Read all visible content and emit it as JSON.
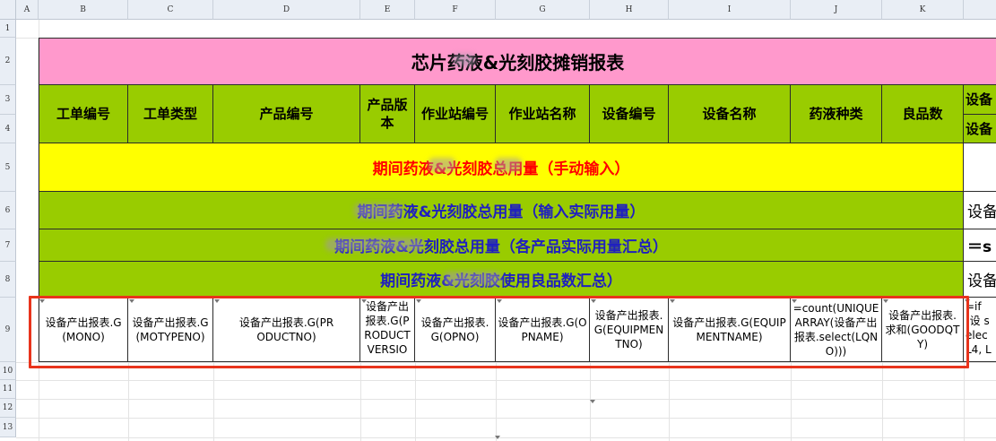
{
  "columns": [
    "A",
    "B",
    "C",
    "D",
    "E",
    "F",
    "G",
    "H",
    "I",
    "J",
    "K"
  ],
  "rows": [
    "1",
    "2",
    "3",
    "4",
    "5",
    "6",
    "7",
    "8",
    "9",
    "10",
    "11",
    "12",
    "13"
  ],
  "title": "芯片药液&光刻胶摊销报表",
  "headers": {
    "mono": "工单编号",
    "motype": "工单类型",
    "productno": "产品编号",
    "productversion": "产品版本",
    "opno": "作业站编号",
    "opname": "作业站名称",
    "equipmentno": "设备编号",
    "equipmentname": "设备名称",
    "liquid_type": "药液种类",
    "good_qty": "良品数",
    "k3_partial": "设备",
    "k4_partial": "设备"
  },
  "bands": {
    "row5": "期间药液&光刻胶总用量（手动输入）",
    "row6": "期间药液&光刻胶总用量（输入实际用量）",
    "row7": "期间药液&光刻胶总用量（各产品实际用量汇总）",
    "row8": "期间药液&光刻胶使用良品数汇总）"
  },
  "side": {
    "row6": "设备",
    "row7": "＝s",
    "row8": "设备"
  },
  "formulas": {
    "b": "设备产出报表.G(MONO)",
    "c": "设备产出报表.G(MOTYPENO)",
    "d": "设备产出报表.G(PRODUCTNO)",
    "e": "设备产出报表.G(PRODUCTVERSIO",
    "f": "设备产出报表.G(OPNO)",
    "g": "设备产出报表.G(OPNAME)",
    "h": "设备产出报表.G(EQUIPMENTNO)",
    "i": "设备产出报表.G(EQUIPMENTNAME)",
    "j": "=count(UNIQUEARRAY(设备产出报表.select(LQNO)))",
    "k": "设备产出报表.求和(GOODQTY)",
    "extra": "=if(设 selec L4, L"
  }
}
